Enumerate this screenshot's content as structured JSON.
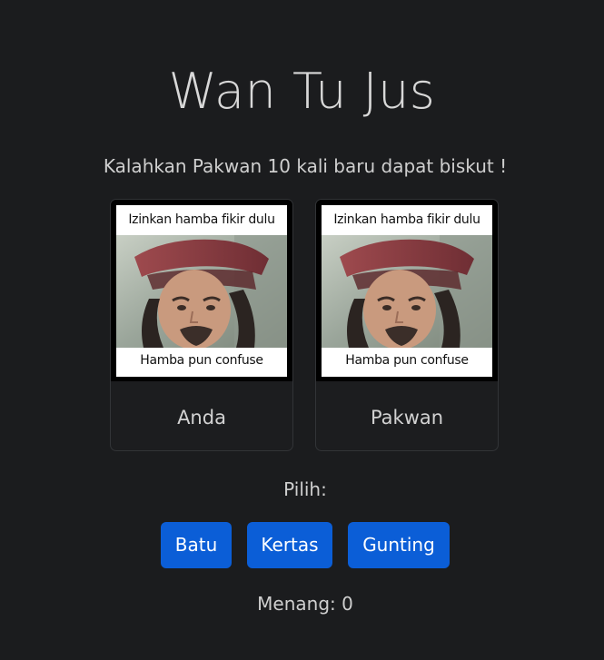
{
  "game": {
    "title": "Wan Tu Jus",
    "subtitle": "Kalahkan Pakwan 10 kali baru dapat biskut !",
    "players": [
      {
        "label": "Anda",
        "meme_top": "Izinkan hamba fikir dulu",
        "meme_bottom": "Hamba pun confuse"
      },
      {
        "label": "Pakwan",
        "meme_top": "Izinkan hamba fikir dulu",
        "meme_bottom": "Hamba pun confuse"
      }
    ],
    "choose_label": "Pilih:",
    "buttons": {
      "rock": "Batu",
      "paper": "Kertas",
      "scissors": "Gunting"
    },
    "score_text": "Menang: 0"
  },
  "colors": {
    "background": "#1b1c1e",
    "button": "#0b5ed7",
    "text": "#d6d6d6",
    "card_border": "#323437"
  }
}
